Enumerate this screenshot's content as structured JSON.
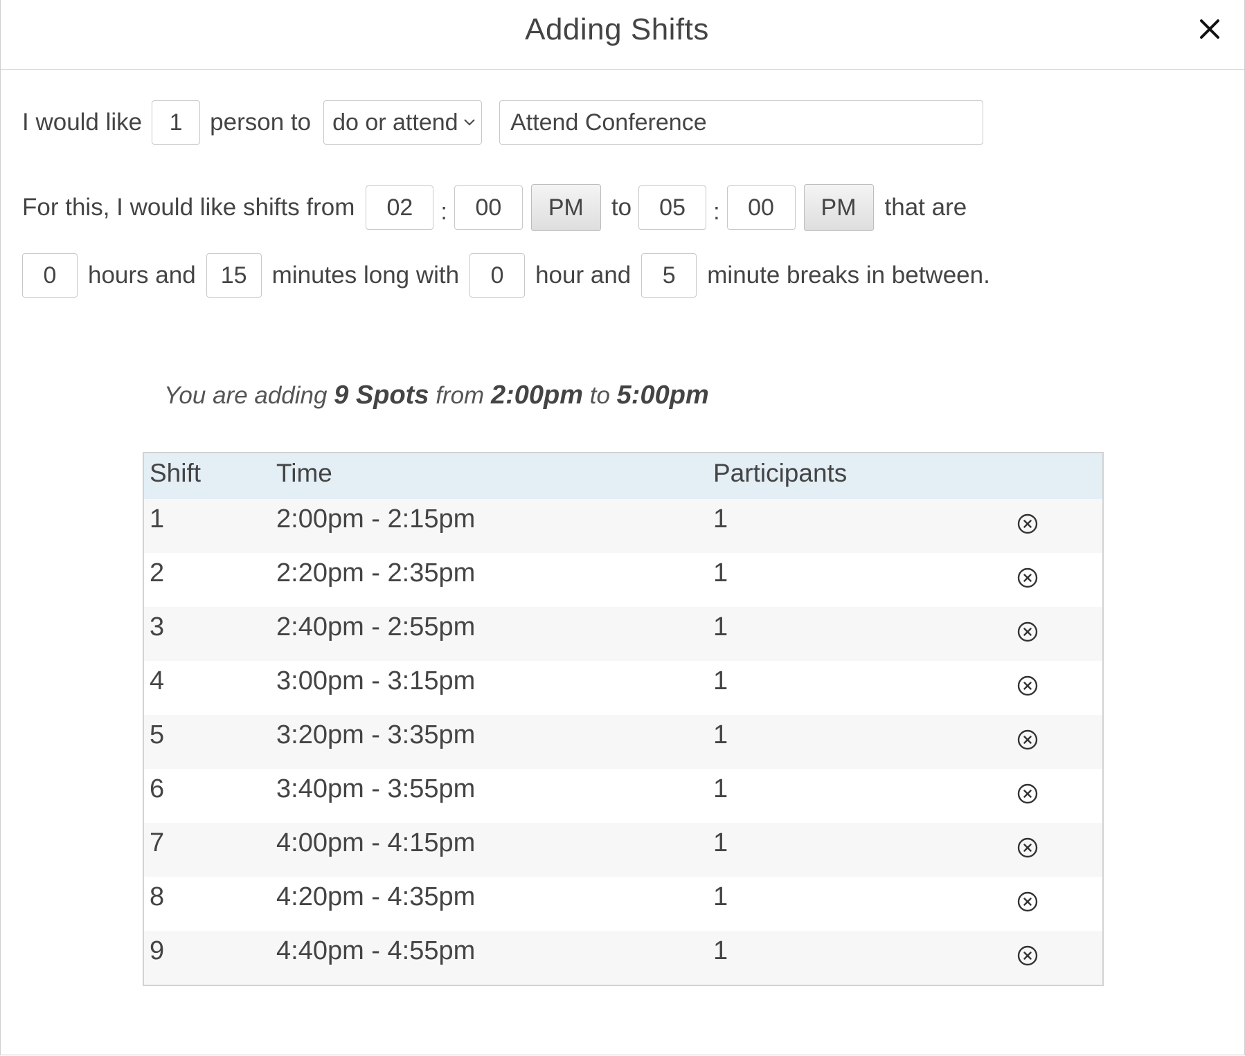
{
  "modal": {
    "title": "Adding Shifts"
  },
  "form": {
    "row1": {
      "prefix": "I would like",
      "count": "1",
      "middle": "person to",
      "action_select": "do or attend",
      "task_name": "Attend Conference"
    },
    "row2": {
      "prefix": "For this, I would like shifts from",
      "start_hour": "02",
      "start_minute": "00",
      "start_ampm": "PM",
      "to_label": "to",
      "end_hour": "05",
      "end_minute": "00",
      "end_ampm": "PM",
      "suffix": "that are",
      "colon": ":"
    },
    "row3": {
      "length_hours": "0",
      "hours_label": "hours and",
      "length_minutes": "15",
      "minutes_label": "minutes long with",
      "break_hours": "0",
      "break_hours_label": "hour and",
      "break_minutes": "5",
      "suffix": "minute breaks in between."
    }
  },
  "summary": {
    "part1": "You are adding",
    "spots": "9 Spots",
    "part2": "from",
    "start": "2:00pm",
    "part3": "to",
    "end": "5:00pm"
  },
  "table": {
    "headers": [
      "Shift",
      "Time",
      "Participants"
    ],
    "rows": [
      {
        "shift": "1",
        "time": "2:00pm - 2:15pm",
        "participants": "1"
      },
      {
        "shift": "2",
        "time": "2:20pm - 2:35pm",
        "participants": "1"
      },
      {
        "shift": "3",
        "time": "2:40pm - 2:55pm",
        "participants": "1"
      },
      {
        "shift": "4",
        "time": "3:00pm - 3:15pm",
        "participants": "1"
      },
      {
        "shift": "5",
        "time": "3:20pm - 3:35pm",
        "participants": "1"
      },
      {
        "shift": "6",
        "time": "3:40pm - 3:55pm",
        "participants": "1"
      },
      {
        "shift": "7",
        "time": "4:00pm - 4:15pm",
        "participants": "1"
      },
      {
        "shift": "8",
        "time": "4:20pm - 4:35pm",
        "participants": "1"
      },
      {
        "shift": "9",
        "time": "4:40pm - 4:55pm",
        "participants": "1"
      }
    ]
  }
}
